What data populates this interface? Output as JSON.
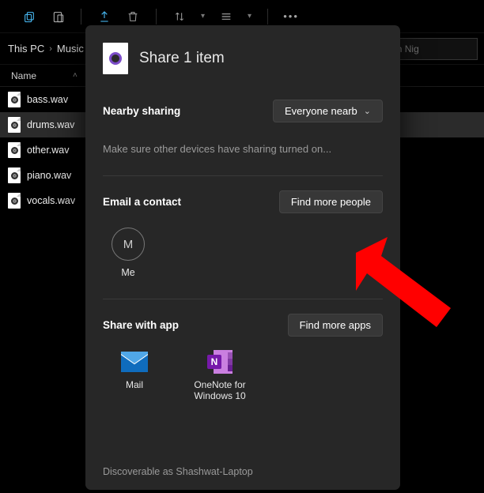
{
  "toolbar": {
    "icons": [
      "copy",
      "paste",
      "share",
      "delete",
      "sort",
      "view",
      "more"
    ]
  },
  "breadcrumb": {
    "parts": [
      "This PC",
      "Music"
    ]
  },
  "search": {
    "placeholder": "Search Nig"
  },
  "list": {
    "header": "Name",
    "files": [
      {
        "name": "bass.wav"
      },
      {
        "name": "drums.wav",
        "selected": true
      },
      {
        "name": "other.wav"
      },
      {
        "name": "piano.wav"
      },
      {
        "name": "vocals.wav"
      }
    ]
  },
  "share": {
    "title": "Share 1 item",
    "nearby": {
      "label": "Nearby sharing",
      "dropdown": "Everyone nearb",
      "hint": "Make sure other devices have sharing turned on..."
    },
    "email": {
      "label": "Email a contact",
      "button": "Find more people",
      "contacts": [
        {
          "initial": "M",
          "name": "Me"
        }
      ]
    },
    "apps": {
      "label": "Share with app",
      "button": "Find more apps",
      "list": [
        {
          "name": "Mail"
        },
        {
          "name": "OneNote for Windows 10"
        }
      ]
    },
    "footer": "Discoverable as Shashwat-Laptop"
  }
}
